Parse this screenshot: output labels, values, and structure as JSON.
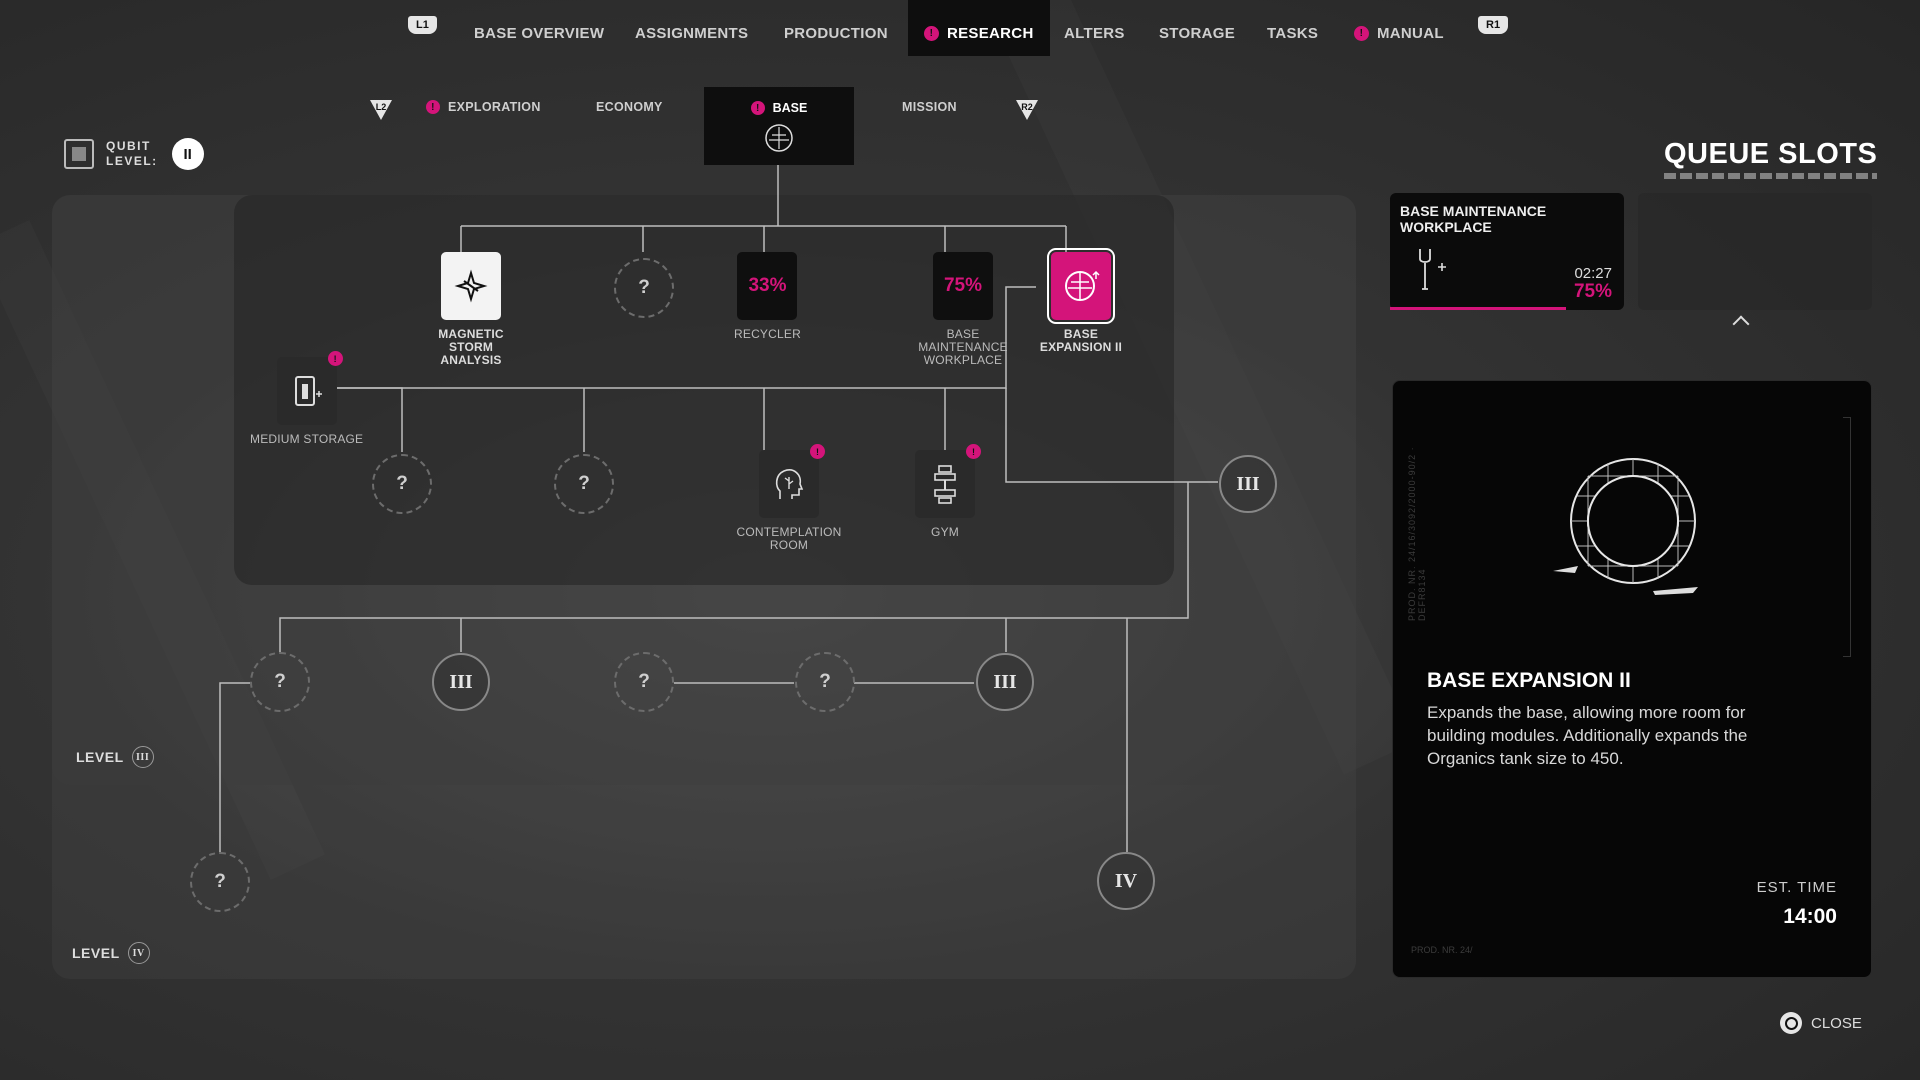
{
  "topnav": {
    "l1": "L1",
    "r1": "R1",
    "tabs": [
      "BASE OVERVIEW",
      "ASSIGNMENTS",
      "PRODUCTION",
      "RESEARCH",
      "ALTERS",
      "STORAGE",
      "TASKS",
      "MANUAL"
    ],
    "active": "RESEARCH"
  },
  "subnav": {
    "l2": "L2",
    "r2": "R2",
    "tabs": [
      "EXPLORATION",
      "ECONOMY",
      "BASE",
      "MISSION"
    ],
    "active": "BASE"
  },
  "qubit": {
    "label_line1": "QUBIT",
    "label_line2": "LEVEL:",
    "level": "II"
  },
  "tree": {
    "magnetic": "MAGNETIC STORM ANALYSIS",
    "recycler": {
      "pct": "33%",
      "label": "RECYCLER"
    },
    "maintenance": {
      "pct": "75%",
      "label": "BASE MAINTENANCE WORKPLACE"
    },
    "expansion": "BASE EXPANSION II",
    "medium_storage": "MEDIUM STORAGE",
    "contemplation": "CONTEMPLATION ROOM",
    "gym": "GYM",
    "unknown": "?",
    "roman3": "III",
    "roman4": "IV"
  },
  "levels": {
    "level_word": "LEVEL",
    "l3": "III",
    "l4": "IV"
  },
  "queue": {
    "title": "QUEUE SLOTS",
    "slot1": {
      "title": "BASE MAINTENANCE WORKPLACE",
      "time": "02:27",
      "pct": "75%",
      "progress": 0.75
    }
  },
  "detail": {
    "name": "BASE EXPANSION II",
    "description": "Expands the base, allowing more room for building modules. Additionally expands the Organics tank size to 450.",
    "est_label": "EST. TIME",
    "est_time": "14:00",
    "vertical_text": "PROD. NR. 24/16/3092/2000-90/2 · DEFR8134",
    "prod": "PROD. NR. 24/"
  },
  "close": "CLOSE",
  "colors": {
    "accent": "#d4147a",
    "panel": "#060606"
  }
}
